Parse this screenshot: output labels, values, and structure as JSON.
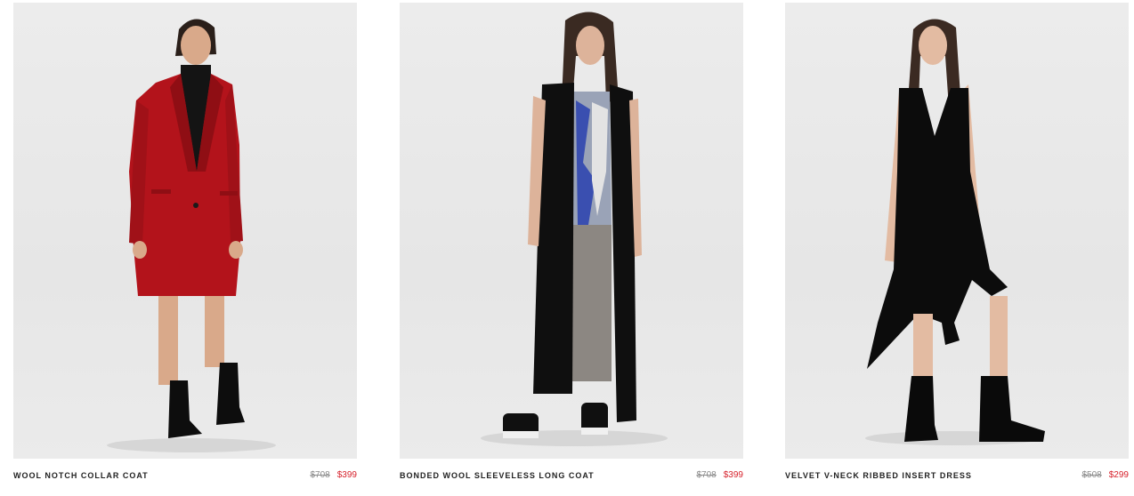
{
  "products": [
    {
      "name": "WOOL NOTCH COLLAR COAT",
      "original_price": "$708",
      "sale_price": "$399",
      "image_label": "model-in-red-wool-coat"
    },
    {
      "name": "BONDED WOOL SLEEVELESS LONG COAT",
      "original_price": "$708",
      "sale_price": "$399",
      "image_label": "model-in-black-sleeveless-long-coat"
    },
    {
      "name": "VELVET V-NECK RIBBED INSERT DRESS",
      "original_price": "$508",
      "sale_price": "$299",
      "image_label": "model-in-black-velvet-dress"
    }
  ],
  "colors": {
    "sale_price": "#d6212b",
    "original_price": "#8a8a8a",
    "product_name": "#222222",
    "photo_background": "#e9e9e9",
    "coat_red": "#b3131b",
    "garment_black": "#111111"
  }
}
